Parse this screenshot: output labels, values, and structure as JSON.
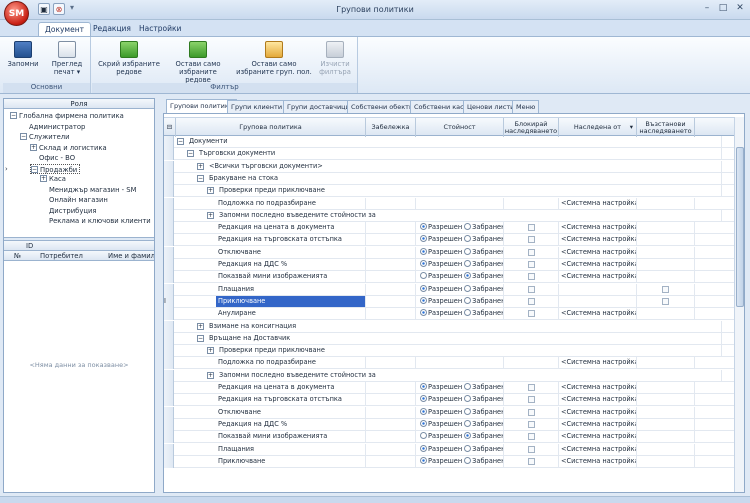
{
  "window": {
    "title": "Групови политики",
    "app_logo": "SM"
  },
  "ribbon_tabs": [
    "Документ",
    "Редакция",
    "Настройки"
  ],
  "groups": {
    "osnovni": {
      "caption": "Основни",
      "buttons": [
        {
          "label1": "Запомни",
          "label2": "",
          "icon": "save-icon"
        },
        {
          "label1": "Преглед",
          "label2": "печат ▾",
          "icon": "print-preview-icon"
        }
      ]
    },
    "filter": {
      "caption": "Филтър",
      "buttons": [
        {
          "label1": "Скрий избраните",
          "label2": "редове",
          "icon": "hide-rows-icon"
        },
        {
          "label1": "Остави само",
          "label2": "избраните редове",
          "icon": "keep-rows-icon"
        },
        {
          "label1": "Остави само",
          "label2": "избраните груп. пол.",
          "icon": "keep-policies-icon"
        },
        {
          "label1": "Изчисти",
          "label2": "филтъра",
          "icon": "clear-filter-icon"
        }
      ]
    }
  },
  "left": {
    "role_header": "Роля",
    "tree": [
      {
        "t": "Глобална фирмена политика",
        "lvl": 0,
        "box": "−"
      },
      {
        "t": "Администратор",
        "lvl": 1,
        "box": ""
      },
      {
        "t": "Служители",
        "lvl": 1,
        "box": "−"
      },
      {
        "t": "Склад и логистика",
        "lvl": 2,
        "box": "+"
      },
      {
        "t": "Офис - ВО",
        "lvl": 2,
        "box": ""
      },
      {
        "t": "Продажби",
        "lvl": 2,
        "box": "−"
      },
      {
        "t": "Каса",
        "lvl": 3,
        "box": "+"
      },
      {
        "t": "Мениджър магазин - SM",
        "lvl": 3,
        "box": ""
      },
      {
        "t": "Онлайн магазин",
        "lvl": 3,
        "box": ""
      },
      {
        "t": "Дистрибуция",
        "lvl": 3,
        "box": ""
      },
      {
        "t": "Реклама и ключови клиенти",
        "lvl": 3,
        "box": ""
      }
    ],
    "grid2": {
      "id_header": "ID",
      "no_header": "№",
      "user_header": "Потребител",
      "name_header": "Име и фамилия"
    },
    "empty_text": "<Няма данни за показване>"
  },
  "doc_tabs": [
    "Групови политики",
    "Групи клиенти",
    "Групи доставчици",
    "Собствени обекти",
    "Собствени каси",
    "Ценови листи",
    "Меню"
  ],
  "grid": {
    "headers": {
      "policy": "Групова политика",
      "note": "Забележка",
      "value": "Стойност",
      "block1": "Блокирай",
      "block2": "наследяването",
      "inherited": "Наследена от",
      "restore1": "Възстанови",
      "restore2": "наследяването"
    },
    "allowed": "Разрешен",
    "forbidden": "Забранен",
    "rows": [
      {
        "t": "Документи",
        "lvl": 0,
        "box": "−",
        "kind": "g"
      },
      {
        "t": "Търговски документи",
        "lvl": 1,
        "box": "−",
        "kind": "g"
      },
      {
        "t": "<Всички търговски документи>",
        "lvl": 2,
        "box": "+",
        "kind": "g"
      },
      {
        "t": "Бракуване на стока",
        "lvl": 2,
        "box": "−",
        "kind": "g"
      },
      {
        "t": "Проверки преди приключване",
        "lvl": 3,
        "box": "+",
        "kind": "g"
      },
      {
        "t": "Подложка по подразбиране",
        "lvl": 4,
        "box": "",
        "kind": "t",
        "inh": "<Системна настройка>"
      },
      {
        "t": "Запомни последно въведените стойности за",
        "lvl": 3,
        "box": "+",
        "kind": "g"
      },
      {
        "t": "Редакция на цената в документа",
        "lvl": 4,
        "box": "",
        "kind": "r",
        "v": "a",
        "inh": "<Системна настройка>"
      },
      {
        "t": "Редакция на търговската отстъпка",
        "lvl": 4,
        "box": "",
        "kind": "r",
        "v": "a",
        "inh": "<Системна настройка>"
      },
      {
        "t": "Отключване",
        "lvl": 4,
        "box": "",
        "kind": "r",
        "v": "a",
        "inh": "<Системна настройка>"
      },
      {
        "t": "Редакция на ДДС %",
        "lvl": 4,
        "box": "",
        "kind": "r",
        "v": "a",
        "inh": "<Системна настройка>"
      },
      {
        "t": "Показвай мини изображенията",
        "lvl": 4,
        "box": "",
        "kind": "r",
        "v": "f",
        "inh": "<Системна настройка>"
      },
      {
        "t": "Плащания",
        "lvl": 4,
        "box": "",
        "kind": "r",
        "v": "a",
        "inh": "",
        "restore": true
      },
      {
        "t": "Приключване",
        "lvl": 4,
        "box": "",
        "kind": "r",
        "v": "a",
        "inh": "",
        "restore": true,
        "sel": true
      },
      {
        "t": "Анулиране",
        "lvl": 4,
        "box": "",
        "kind": "r",
        "v": "a",
        "inh": "<Системна настройка>"
      },
      {
        "t": "Взимане на консигнация",
        "lvl": 2,
        "box": "+",
        "kind": "g"
      },
      {
        "t": "Връщане на Доставчик",
        "lvl": 2,
        "box": "−",
        "kind": "g"
      },
      {
        "t": "Проверки преди приключване",
        "lvl": 3,
        "box": "+",
        "kind": "g"
      },
      {
        "t": "Подложка по подразбиране",
        "lvl": 4,
        "box": "",
        "kind": "t",
        "inh": "<Системна настройка>"
      },
      {
        "t": "Запомни последно въведените стойности за",
        "lvl": 3,
        "box": "+",
        "kind": "g"
      },
      {
        "t": "Редакция на цената в документа",
        "lvl": 4,
        "box": "",
        "kind": "r",
        "v": "a",
        "inh": "<Системна настройка>"
      },
      {
        "t": "Редакция на търговската отстъпка",
        "lvl": 4,
        "box": "",
        "kind": "r",
        "v": "a",
        "inh": "<Системна настройка>"
      },
      {
        "t": "Отключване",
        "lvl": 4,
        "box": "",
        "kind": "r",
        "v": "a",
        "inh": "<Системна настройка>"
      },
      {
        "t": "Редакция на ДДС %",
        "lvl": 4,
        "box": "",
        "kind": "r",
        "v": "a",
        "inh": "<Системна настройка>"
      },
      {
        "t": "Показвай мини изображенията",
        "lvl": 4,
        "box": "",
        "kind": "r",
        "v": "f",
        "inh": "<Системна настройка>"
      },
      {
        "t": "Плащания",
        "lvl": 4,
        "box": "",
        "kind": "r",
        "v": "a",
        "inh": "<Системна настройка>"
      },
      {
        "t": "Приключване",
        "lvl": 4,
        "box": "",
        "kind": "r",
        "v": "a",
        "inh": "<Системна настройка>"
      }
    ]
  }
}
